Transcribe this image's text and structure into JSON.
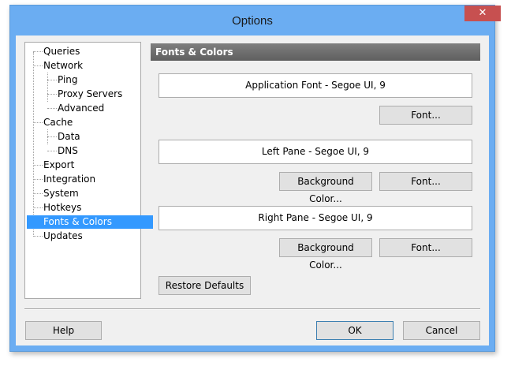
{
  "window": {
    "title": "Options",
    "close_glyph": "✕"
  },
  "tree": {
    "items": [
      {
        "label": "Queries"
      },
      {
        "label": "Network"
      },
      {
        "label": "Ping"
      },
      {
        "label": "Proxy Servers"
      },
      {
        "label": "Advanced"
      },
      {
        "label": "Cache"
      },
      {
        "label": "Data"
      },
      {
        "label": "DNS"
      },
      {
        "label": "Export"
      },
      {
        "label": "Integration"
      },
      {
        "label": "System"
      },
      {
        "label": "Hotkeys"
      },
      {
        "label": "Fonts & Colors",
        "selected": true
      },
      {
        "label": "Updates"
      }
    ]
  },
  "panel": {
    "header": "Fonts & Colors",
    "application_font": "Application Font - Segoe UI, 9",
    "left_pane": "Left Pane - Segoe UI, 9",
    "right_pane": "Right Pane - Segoe UI, 9",
    "font_button": "Font...",
    "background_button": "Background Color...",
    "restore_button": "Restore Defaults"
  },
  "footer": {
    "help": "Help",
    "ok": "OK",
    "cancel": "Cancel"
  },
  "colors": {
    "selection": "#3399ff",
    "title_bar": "#6badf2",
    "close": "#c75050"
  }
}
